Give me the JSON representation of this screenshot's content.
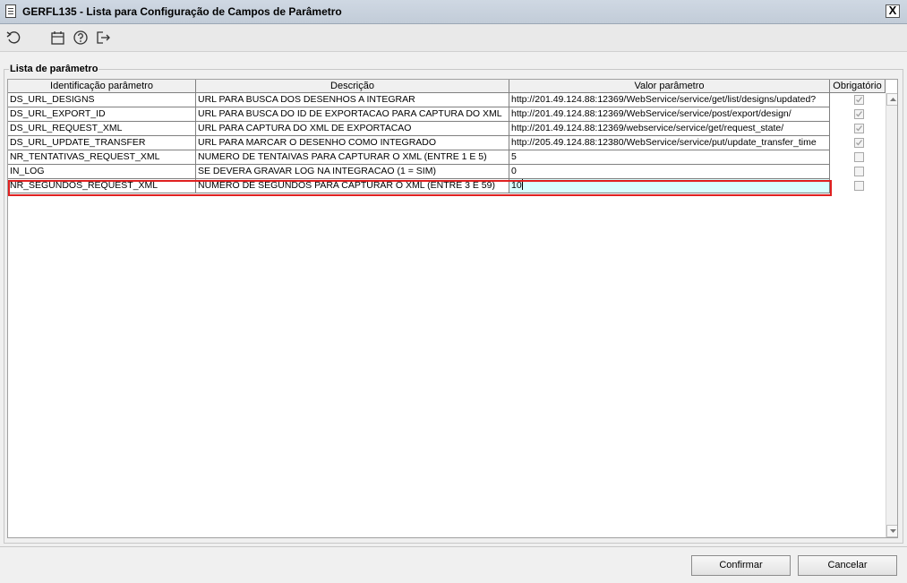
{
  "window": {
    "title": "GERFL135 - Lista para Configuração de Campos de Parâmetro",
    "close_label": "X"
  },
  "toolbar": {
    "icons": [
      "undo-icon",
      "calendar-icon",
      "help-icon",
      "exit-icon"
    ]
  },
  "group": {
    "legend": "Lista de parâmetro"
  },
  "table": {
    "columns": [
      "Identificação parâmetro",
      "Descrição",
      "Valor parâmetro",
      "Obrigatório"
    ],
    "rows": [
      {
        "id": "DS_URL_DESIGNS",
        "descricao": "URL PARA BUSCA DOS DESENHOS A INTEGRAR",
        "valor": "http://201.49.124.88:12369/WebService/service/get/list/designs/updated?",
        "obrigatorio": true
      },
      {
        "id": "DS_URL_EXPORT_ID",
        "descricao": "URL PARA BUSCA DO ID DE EXPORTACAO PARA CAPTURA DO XML",
        "valor": "http://201.49.124.88:12369/WebService/service/post/export/design/",
        "obrigatorio": true
      },
      {
        "id": "DS_URL_REQUEST_XML",
        "descricao": "URL PARA CAPTURA DO XML DE EXPORTACAO",
        "valor": "http://201.49.124.88:12369/webservice/service/get/request_state/",
        "obrigatorio": true
      },
      {
        "id": "DS_URL_UPDATE_TRANSFER",
        "descricao": "URL PARA MARCAR O DESENHO COMO INTEGRADO",
        "valor": "http://205.49.124.88:12380/WebService/service/put/update_transfer_time",
        "obrigatorio": true
      },
      {
        "id": "NR_TENTATIVAS_REQUEST_XML",
        "descricao": "NUMERO DE TENTAIVAS PARA CAPTURAR O XML (ENTRE 1 E 5)",
        "valor": "5",
        "obrigatorio": false
      },
      {
        "id": "IN_LOG",
        "descricao": "SE DEVERA GRAVAR LOG NA INTEGRACAO (1 = SIM)",
        "valor": "0",
        "obrigatorio": false
      },
      {
        "id": "NR_SEGUNDOS_REQUEST_XML",
        "descricao": "NUMERO DE SEGUNDOS PARA CAPTURAR O XML (ENTRE 3 E 59)",
        "valor": "10",
        "obrigatorio": false
      }
    ],
    "selected_row": 6
  },
  "buttons": {
    "confirm_label": "Confirmar",
    "cancel_label": "Cancelar"
  },
  "colors": {
    "selection_outline": "#e02020",
    "edit_cell": "#d8ffff"
  }
}
